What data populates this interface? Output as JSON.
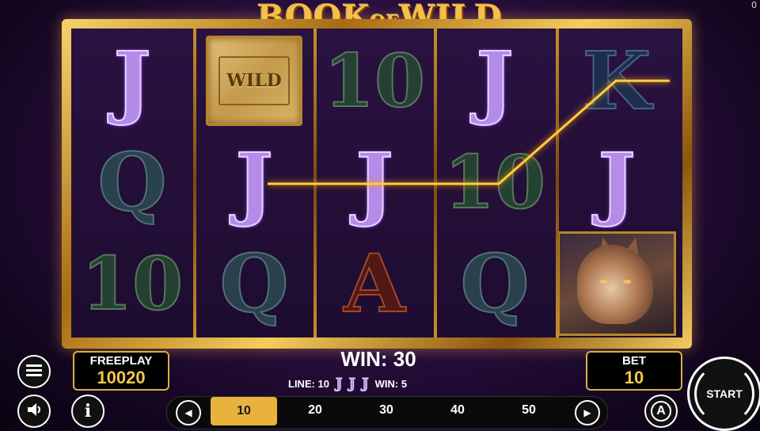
{
  "corner_counter": "0",
  "logo": {
    "title": "BOOK OF WILD",
    "part1": "BOOK",
    "part2": "OF",
    "part3": "WILD"
  },
  "reels": [
    [
      "J",
      "Q",
      "10"
    ],
    [
      "WILD",
      "J",
      "Q"
    ],
    [
      "10",
      "J",
      "A"
    ],
    [
      "J",
      "10",
      "Q"
    ],
    [
      "K",
      "J",
      "WOLF"
    ]
  ],
  "wild_label": "WILD",
  "freeplay": {
    "label": "FREEPLAY",
    "value": "10020"
  },
  "bet": {
    "label": "BET",
    "value": "10"
  },
  "win": {
    "title": "WIN: 30",
    "line_label": "LINE: 10",
    "win_label": "WIN: 5",
    "symbol": "J"
  },
  "bet_options": [
    "10",
    "20",
    "30",
    "40",
    "50"
  ],
  "selected_bet": "10",
  "start_label": "START",
  "icons": {
    "menu": "hamburger-menu-icon",
    "sound": "speaker-icon",
    "info": "info-icon",
    "autoplay": "autoplay-icon",
    "prev": "arrow-left-icon",
    "next": "arrow-right-icon",
    "start": "spin-icon"
  },
  "colors": {
    "gold": "#e8b23c",
    "frame": "#d8b048",
    "payline": "#ffb020",
    "background": "#2a0e40"
  }
}
